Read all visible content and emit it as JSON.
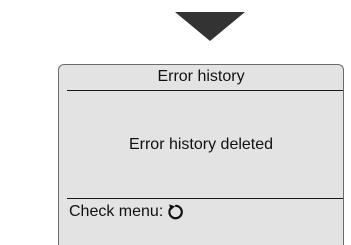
{
  "screen": {
    "title": "Error history",
    "message": "Error history deleted",
    "footer_label": "Check menu:",
    "footer_icon": "return-arrow-icon"
  },
  "colors": {
    "arrow": "#333333",
    "screen_background": "#e3e3e3",
    "screen_border": "#6b6b6b",
    "text": "#111111"
  }
}
